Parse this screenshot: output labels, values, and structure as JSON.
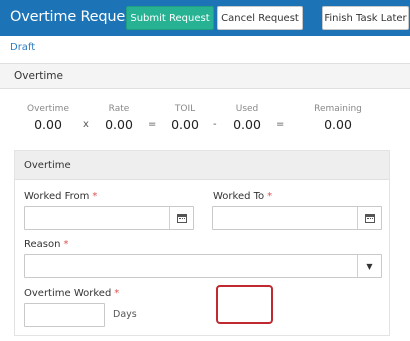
{
  "header": {
    "title": "Overtime Request",
    "submit_label": "Submit Request",
    "cancel_label": "Cancel Request",
    "finish_label": "Finish Task Later"
  },
  "status": "Draft",
  "section_title": "Overtime",
  "summary": {
    "overtime": {
      "label": "Overtime",
      "value": "0.00"
    },
    "rate": {
      "label": "Rate",
      "value": "0.00"
    },
    "toil": {
      "label": "TOIL",
      "value": "0.00"
    },
    "used": {
      "label": "Used",
      "value": "0.00"
    },
    "remaining": {
      "label": "Remaining",
      "value": "0.00"
    },
    "op_multiply": "x",
    "op_equals1": "=",
    "op_minus": "-",
    "op_equals2": "="
  },
  "panel": {
    "title": "Overtime",
    "worked_from_label": "Worked From",
    "worked_to_label": "Worked To",
    "reason_label": "Reason",
    "overtime_worked_label": "Overtime Worked",
    "required_mark": "*",
    "days_unit": "Days",
    "reason_caret": "▼"
  },
  "colors": {
    "header_bg": "#1c74b6",
    "submit_bg": "#27b393",
    "required": "#d9534f",
    "highlight": "#c0292f"
  },
  "icons": [
    "calendar-icon",
    "chevron-down-icon"
  ]
}
